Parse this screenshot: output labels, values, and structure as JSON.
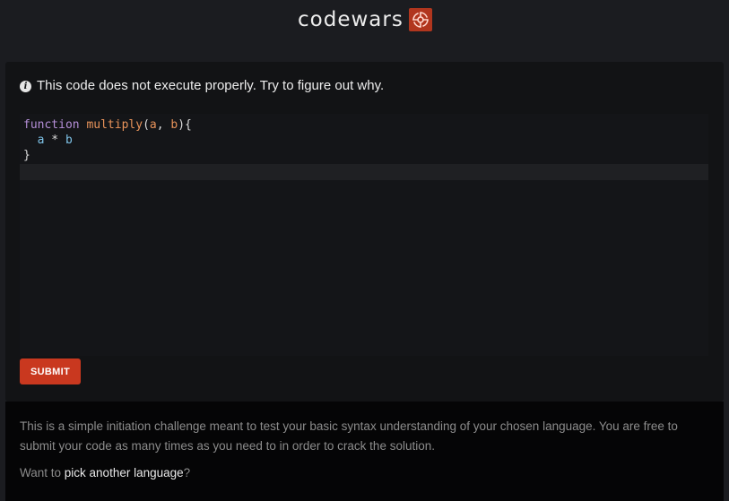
{
  "header": {
    "logo_text": "codewars"
  },
  "card": {
    "info_text": "This code does not execute properly. Try to figure out why.",
    "code": {
      "line1": {
        "kw": "function",
        "fn": "multiply",
        "open": "(",
        "p1": "a",
        "comma": ", ",
        "p2": "b",
        "close": "){"
      },
      "line2": {
        "indent": "  ",
        "a": "a",
        "op": " * ",
        "b": "b"
      },
      "line3": "}"
    },
    "submit_label": "SUBMIT"
  },
  "footer": {
    "description": "This is a simple initiation challenge meant to test your basic syntax understanding of your chosen language. You are free to submit your code as many times as you need to in order to crack the solution.",
    "want_prefix": "Want to ",
    "want_link": "pick another language",
    "want_suffix": "?"
  },
  "colors": {
    "accent": "#c9381f",
    "background": "#1b1c20"
  }
}
